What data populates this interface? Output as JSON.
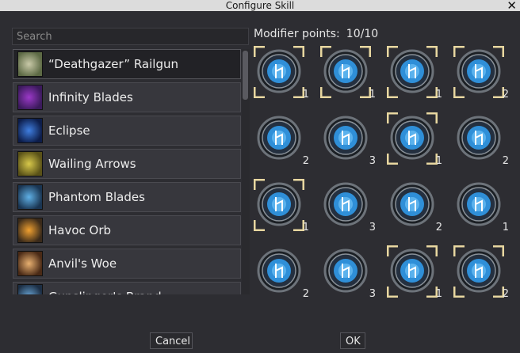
{
  "window": {
    "title": "Configure Skill"
  },
  "search": {
    "placeholder": "Search",
    "value": ""
  },
  "skills": [
    {
      "name": "“Deathgazer” Railgun",
      "icon": "railgun-icon",
      "selected": true,
      "colors": [
        "#c9c9a8",
        "#5d6a45"
      ]
    },
    {
      "name": "Infinity Blades",
      "icon": "infinity-blades-icon",
      "selected": false,
      "colors": [
        "#9b39c8",
        "#3b1a5c"
      ]
    },
    {
      "name": "Eclipse",
      "icon": "eclipse-icon",
      "selected": false,
      "colors": [
        "#3f7ee0",
        "#0d1d4a"
      ]
    },
    {
      "name": "Wailing Arrows",
      "icon": "wailing-arrows-icon",
      "selected": false,
      "colors": [
        "#d7c84a",
        "#5a5218"
      ]
    },
    {
      "name": "Phantom Blades",
      "icon": "phantom-blades-icon",
      "selected": false,
      "colors": [
        "#5fb0e6",
        "#1a3552"
      ]
    },
    {
      "name": "Havoc Orb",
      "icon": "havoc-orb-icon",
      "selected": false,
      "colors": [
        "#f0a030",
        "#3a2a1a"
      ]
    },
    {
      "name": "Anvil's Woe",
      "icon": "anvils-woe-icon",
      "selected": false,
      "colors": [
        "#e8b070",
        "#4a2a16"
      ]
    },
    {
      "name": "Gunslinger's Brand",
      "icon": "gunslingers-brand-icon",
      "selected": false,
      "colors": [
        "#6aa6d6",
        "#1c2e44"
      ]
    }
  ],
  "modifier_points": {
    "label": "Modifier points:",
    "value": "10/10"
  },
  "modifiers": [
    {
      "count": "1",
      "selected": true
    },
    {
      "count": "1",
      "selected": true
    },
    {
      "count": "1",
      "selected": true
    },
    {
      "count": "2",
      "selected": true
    },
    {
      "count": "2",
      "selected": false
    },
    {
      "count": "3",
      "selected": false
    },
    {
      "count": "1",
      "selected": true
    },
    {
      "count": "2",
      "selected": false
    },
    {
      "count": "1",
      "selected": true
    },
    {
      "count": "3",
      "selected": false
    },
    {
      "count": "2",
      "selected": false
    },
    {
      "count": "1",
      "selected": false
    },
    {
      "count": "2",
      "selected": false
    },
    {
      "count": "3",
      "selected": false
    },
    {
      "count": "1",
      "selected": true
    },
    {
      "count": "2",
      "selected": true
    }
  ],
  "buttons": {
    "cancel": "Cancel",
    "ok": "OK"
  },
  "colors": {
    "accent_frame": "#e8d7a0",
    "rune_blue": "#2f8fd8"
  }
}
